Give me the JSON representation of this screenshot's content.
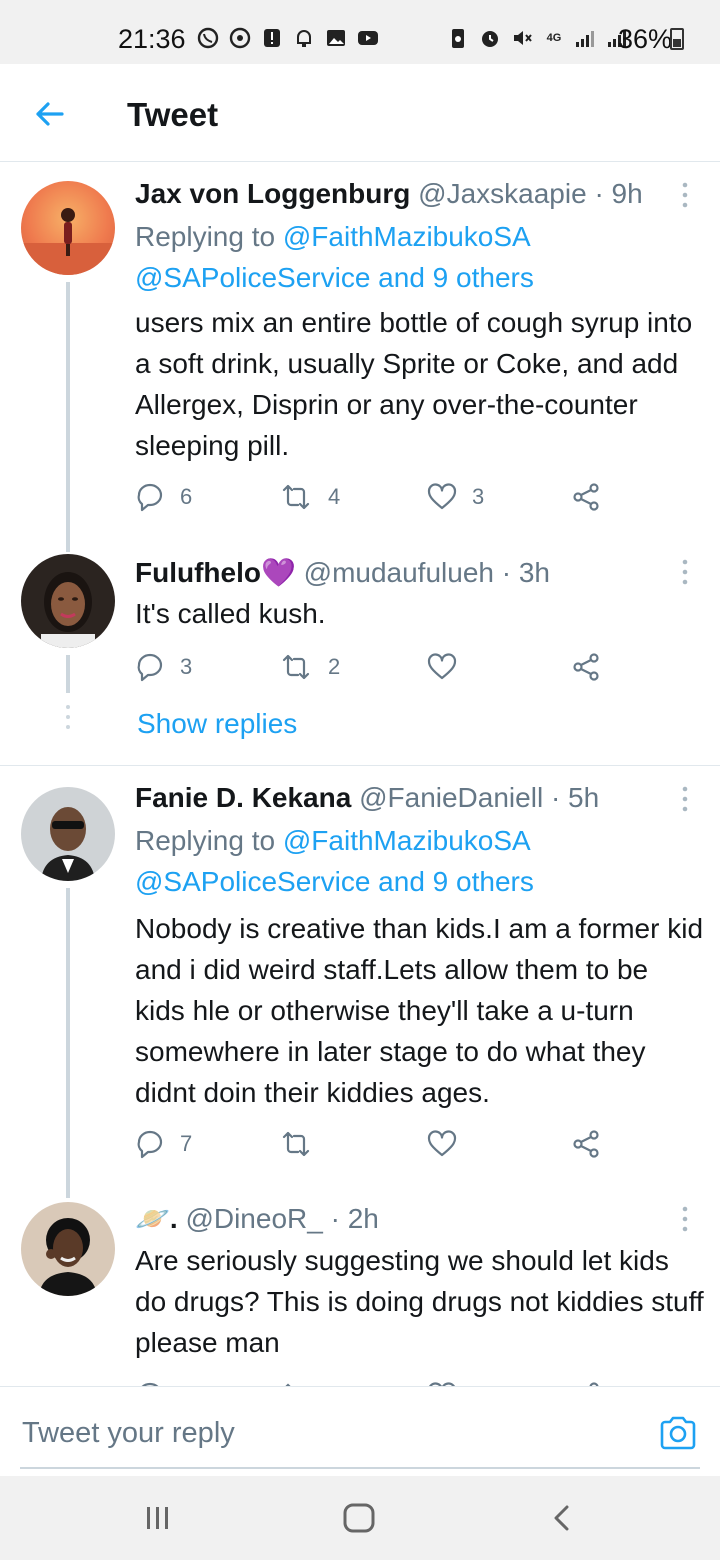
{
  "status_bar": {
    "time": "21:36",
    "battery": "36%",
    "network": "4G"
  },
  "header": {
    "title": "Tweet"
  },
  "tweets": [
    {
      "name": "Jax von Loggenburg",
      "handle": "@Jaxskaapie",
      "time": "· 9h",
      "replying_label": "Replying to ",
      "replying_mention1": "@FaithMazibukoSA",
      "replying_mention2": "@SAPoliceService and 9 others",
      "text": "users mix an entire bottle of cough syrup into a soft drink, usually Sprite or Coke, and add Allergex, Disprin or any over-the-counter sleeping pill.",
      "replies": "6",
      "retweets": "4",
      "likes": "3"
    },
    {
      "name": "Fulufhelo",
      "name_emoji": "💜",
      "handle": "@mudaufulueh",
      "time": "· 3h",
      "text": "It's called kush.",
      "replies": "3",
      "retweets": "2",
      "likes": ""
    },
    {
      "name": "Fanie D. Kekana",
      "handle": "@FanieDaniell",
      "time": "· 5h",
      "replying_label": "Replying to ",
      "replying_mention1": "@FaithMazibukoSA",
      "replying_mention2": "@SAPoliceService and 9 others",
      "text": "Nobody is creative than kids.I am a former kid and i did weird staff.Lets allow them to be kids hle or otherwise they'll take a u-turn somewhere in later stage to do what they didnt doin their kiddies ages.",
      "replies": "7",
      "retweets": "",
      "likes": ""
    },
    {
      "name": "🪐.",
      "handle": "@DineoR_",
      "time": "· 2h",
      "text": "Are seriously suggesting we should let kids do drugs? This is doing drugs not kiddies stuff please man"
    }
  ],
  "show_replies": "Show replies",
  "reply_bar": {
    "placeholder": "Tweet your reply"
  },
  "colors": {
    "accent": "#1da1f2",
    "text": "#14171a",
    "muted": "#657786",
    "line": "#ccd6dd"
  }
}
